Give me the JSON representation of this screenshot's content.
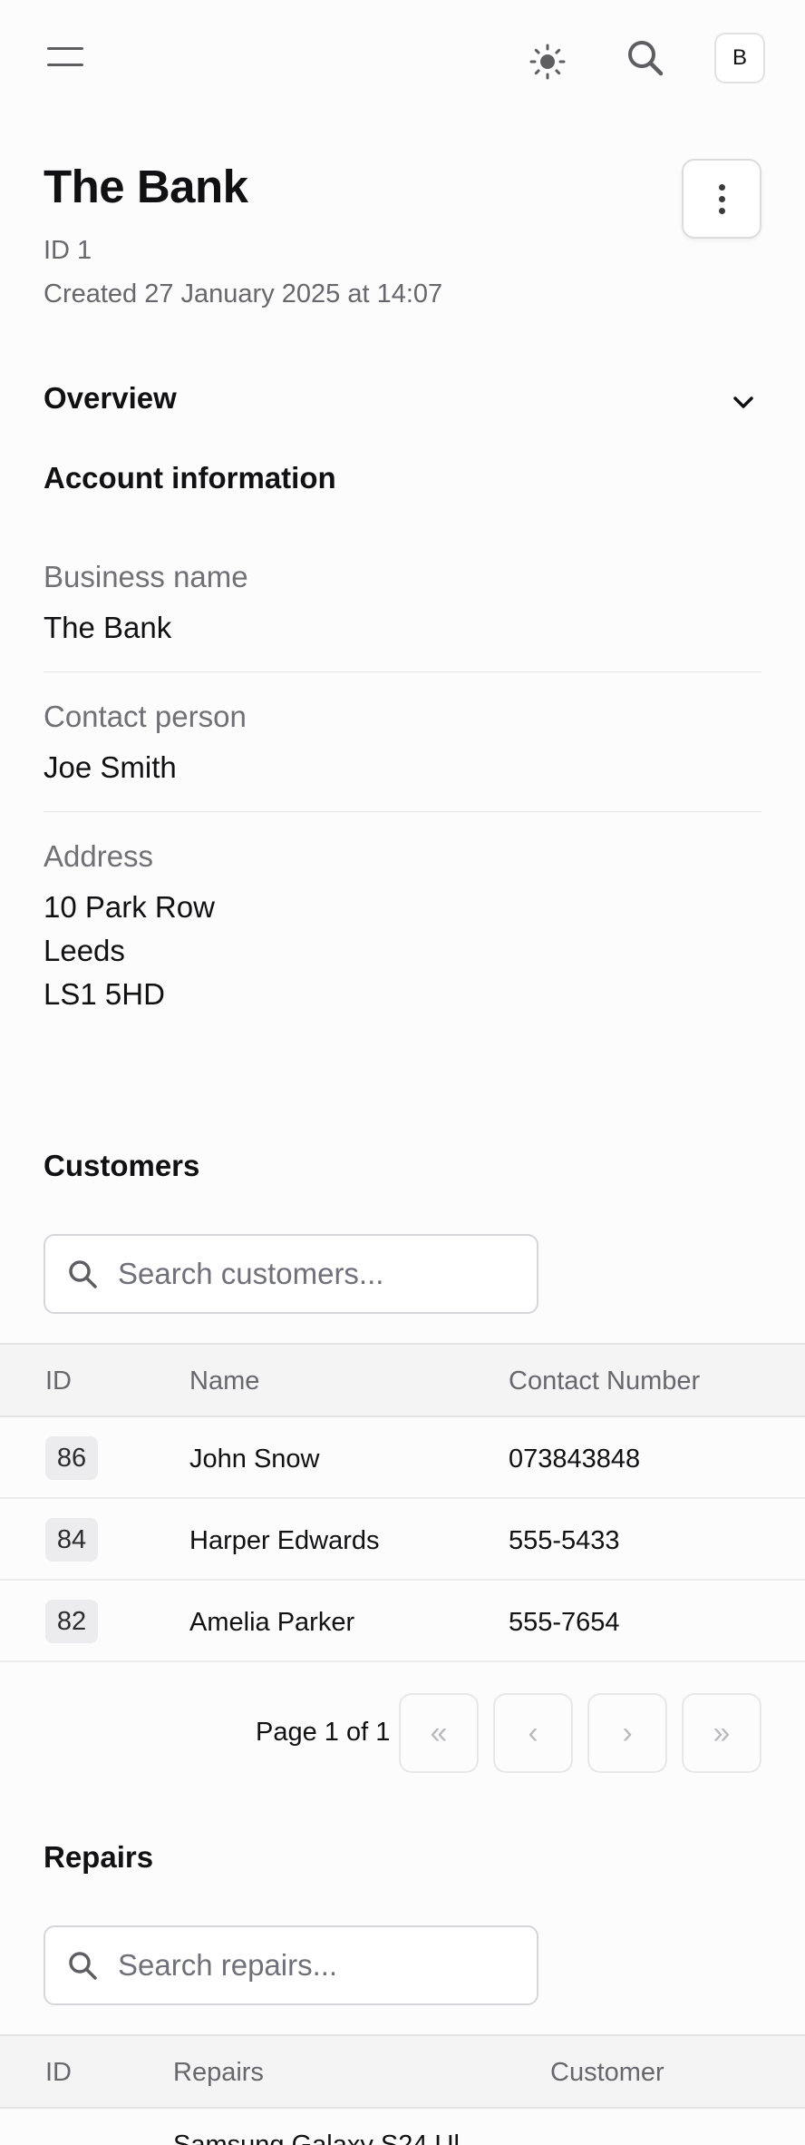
{
  "header": {
    "avatar_initial": "B",
    "icons": [
      "menu-icon",
      "sun-icon",
      "search-icon"
    ]
  },
  "record": {
    "title": "The Bank",
    "id_text": "ID 1",
    "created_text": "Created 27 January 2025 at 14:07"
  },
  "overview": {
    "title": "Overview",
    "account_heading": "Account information",
    "fields": [
      {
        "label": "Business name",
        "value": "The Bank"
      },
      {
        "label": "Contact person",
        "value": "Joe Smith"
      },
      {
        "label": "Address",
        "lines": [
          "10 Park Row",
          "Leeds",
          "LS1 5HD"
        ]
      }
    ]
  },
  "customers": {
    "heading": "Customers",
    "search_placeholder": "Search customers...",
    "columns": [
      "ID",
      "Name",
      "Contact Number"
    ],
    "rows": [
      {
        "id": "86",
        "name": "John Snow",
        "contact": "073843848"
      },
      {
        "id": "84",
        "name": "Harper Edwards",
        "contact": "555-5433"
      },
      {
        "id": "82",
        "name": "Amelia Parker",
        "contact": "555-7654"
      }
    ],
    "pagination": {
      "text": "Page 1 of 1",
      "first": "«",
      "prev": "‹",
      "next": "›",
      "last": "»"
    }
  },
  "repairs": {
    "heading": "Repairs",
    "search_placeholder": "Search repairs...",
    "columns": [
      "ID",
      "Repairs",
      "Customer"
    ],
    "first_row_partial": "Samsung Galaxy S24 Ul"
  },
  "colors": {
    "background": "#fcfcfc",
    "text": "#111113",
    "muted": "#67676d",
    "header_bg": "#f4f4f5"
  }
}
